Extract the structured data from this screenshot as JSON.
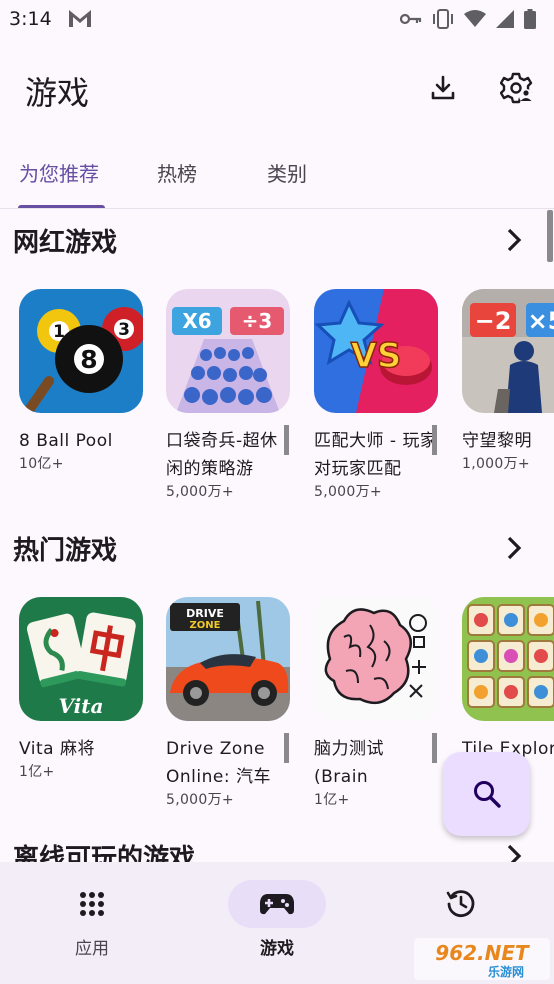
{
  "status_bar": {
    "time": "3:14",
    "icons": [
      "gmail-icon",
      "key-icon",
      "vibrate-icon",
      "wifi-icon",
      "signal-icon",
      "battery-icon"
    ]
  },
  "header": {
    "title": "游戏",
    "actions": [
      "download-icon",
      "settings-icon"
    ]
  },
  "tabs": [
    {
      "label": "为您推荐",
      "active": true
    },
    {
      "label": "热榜",
      "active": false
    },
    {
      "label": "类别",
      "active": false
    }
  ],
  "sections": [
    {
      "title": "网红游戏",
      "items": [
        {
          "name": "8 Ball Pool",
          "count": "10亿+"
        },
        {
          "name": "口袋奇兵-超休闲的策略游",
          "count": "5,000万+"
        },
        {
          "name": "匹配大师 - 玩家对玩家匹配",
          "count": "5,000万+"
        },
        {
          "name": "守望黎明",
          "count": "1,000万+"
        }
      ]
    },
    {
      "title": "热门游戏",
      "items": [
        {
          "name": "Vita 麻将",
          "count": "1亿+"
        },
        {
          "name": "Drive Zone Online: 汽车",
          "count": "5,000万+"
        },
        {
          "name": "脑力测试 (Brain",
          "count": "1亿+"
        },
        {
          "name": "Tile Explor",
          "count": ""
        }
      ]
    },
    {
      "title": "离线可玩的游戏",
      "items": []
    }
  ],
  "fab": {
    "icon": "search-icon"
  },
  "bottom_nav": [
    {
      "label": "应用",
      "icon": "apps-grid-icon",
      "active": false
    },
    {
      "label": "游戏",
      "icon": "gamepad-icon",
      "active": true
    },
    {
      "label": "",
      "icon": "history-icon",
      "active": false
    }
  ],
  "watermark": {
    "text": "962.NET",
    "subtext": "乐游网"
  },
  "colors": {
    "background": "#fdf7fe",
    "accent": "#6750a4",
    "nav_background": "#f3edf7",
    "fab_background": "#eaddff"
  }
}
